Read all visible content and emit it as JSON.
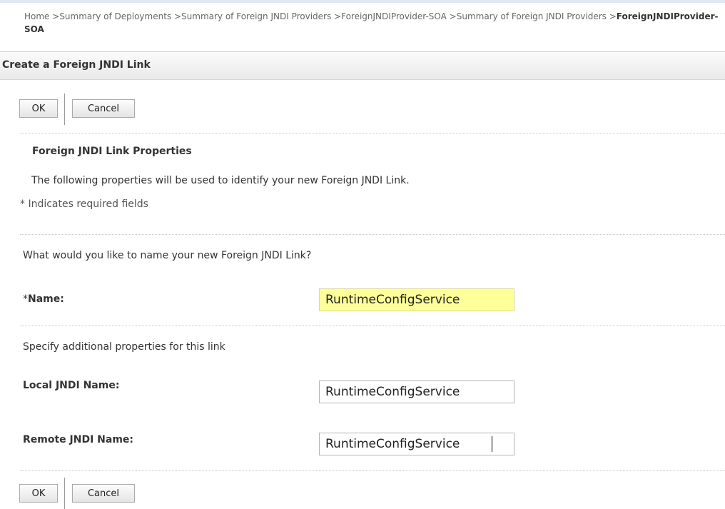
{
  "breadcrumb": {
    "items": [
      "Home >",
      "Summary of Deployments >",
      "Summary of Foreign JNDI Providers >",
      "ForeignJNDIProvider-SOA >",
      "Summary of Foreign JNDI Providers >"
    ],
    "current": "ForeignJNDIProvider-SOA"
  },
  "panel": {
    "title": "Create a Foreign JNDI Link"
  },
  "toolbar_top": {
    "ok_label": "OK",
    "cancel_label": "Cancel"
  },
  "toolbar_bottom": {
    "ok_label": "OK",
    "cancel_label": "Cancel"
  },
  "section": {
    "heading": "Foreign JNDI Link Properties",
    "description": "The following properties will be used to identify your new Foreign JNDI Link.",
    "required_note": "* Indicates required fields"
  },
  "name_section": {
    "question": "What would you like to name your new Foreign JNDI Link?",
    "required_star": "*",
    "label": "Name:",
    "value": "RuntimeConfigService"
  },
  "additional_section": {
    "intro": "Specify additional properties for this link",
    "local_label": "Local JNDI Name:",
    "local_value": "RuntimeConfigService",
    "remote_label": "Remote JNDI Name:",
    "remote_value": "RuntimeConfigService"
  },
  "colors": {
    "required_field_bg": "#ffff99",
    "header_bg": "#eeeeee",
    "top_strip": "#dde8f4"
  }
}
